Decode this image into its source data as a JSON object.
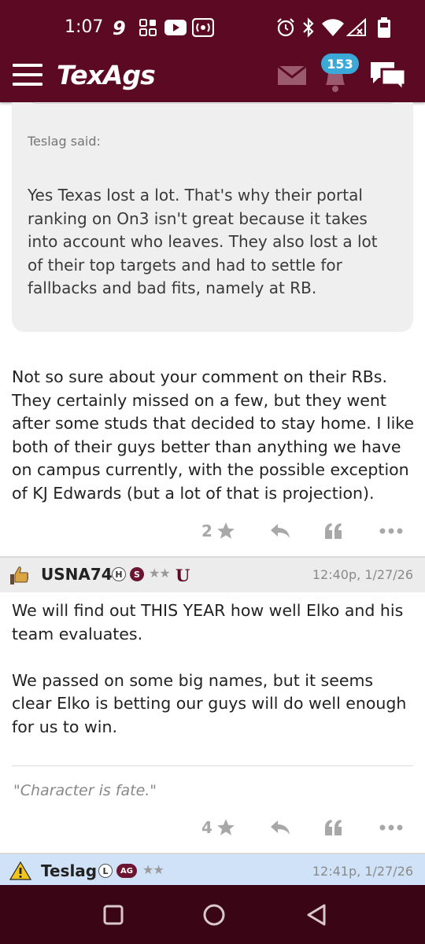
{
  "status_bar": {
    "time": "1:07",
    "left_icons": [
      "nine-icon",
      "grid-icon",
      "youtube-icon",
      "podcast-icon"
    ],
    "right_icons": [
      "alarm-icon",
      "bluetooth-icon",
      "wifi-icon",
      "signal-icon",
      "battery-icon"
    ]
  },
  "app_bar": {
    "logo": "TexAgs",
    "notification_count": "153",
    "icons": [
      "menu-icon",
      "mail-icon",
      "bell-icon",
      "chat-icon"
    ]
  },
  "quoted_post": {
    "attribution": "Teslag said:",
    "text": "Yes Texas lost a lot. That's why their portal ranking on On3 isn't great because it takes into account who leaves. They also lost a lot of their top targets and had to settle for fallbacks and bad fits, namely at RB."
  },
  "reply_post": {
    "text": "Not so sure about your comment on their RBs. They certainly missed on a few, but they went after some studs that decided to stay home. I like both of their guys better than anything we have on campus currently, with the possible exception of KJ Edwards (but a lot of that is projection).",
    "star_count": "2"
  },
  "posts": [
    {
      "username": "USNA74",
      "badges": [
        "H",
        "S"
      ],
      "stars": "★★",
      "emblem": "U",
      "timestamp": "12:40p, 1/27/26",
      "text": "We will find out THIS YEAR how well Elko and his team evaluates.\n\nWe passed on some big names, but it seems clear Elko is betting our guys will do well enough for us to win.",
      "signature": "\"Character is fate.\"",
      "star_count": "4"
    },
    {
      "username": "Teslag",
      "badges": [
        "L",
        "AG"
      ],
      "stars": "★★",
      "timestamp": "12:41p, 1/27/26"
    }
  ],
  "colors": {
    "brand": "#5c0a24",
    "nav_bar": "#3a0615",
    "badge": "#3aa9d8",
    "highlight_header": "#cfe2f7"
  }
}
